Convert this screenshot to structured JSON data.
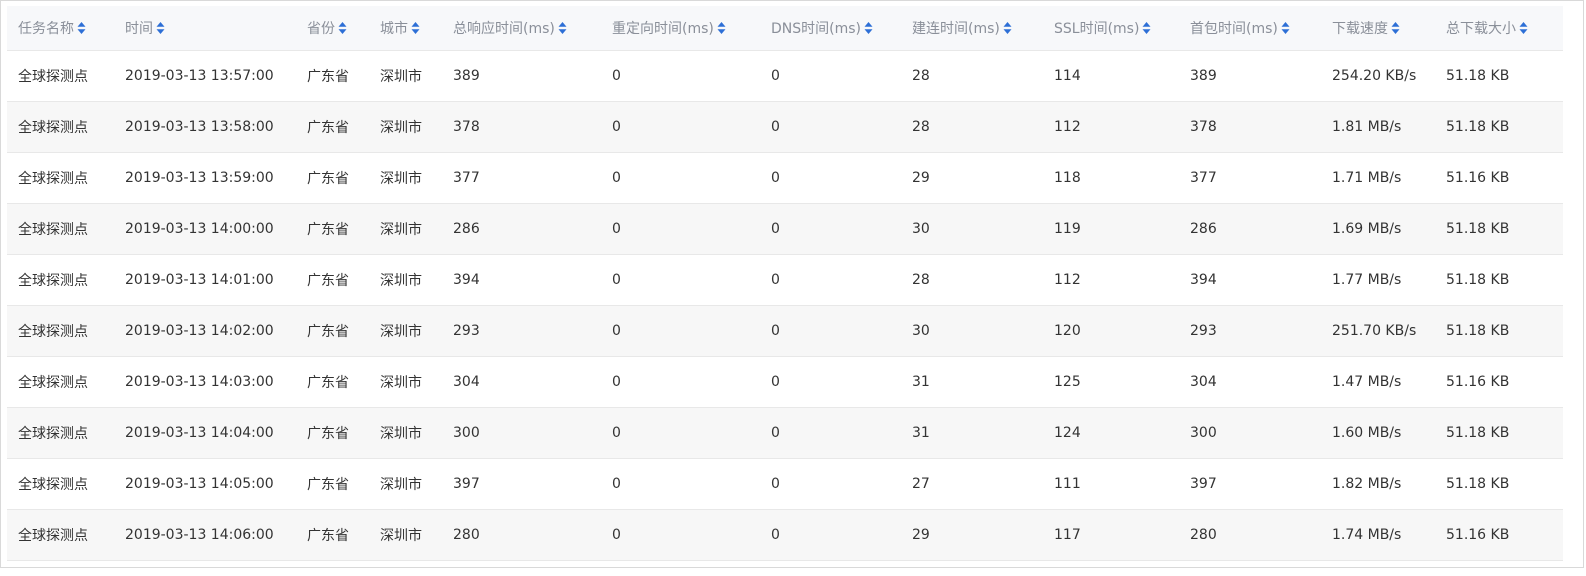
{
  "table": {
    "columns": [
      {
        "key": "task",
        "label": "任务名称"
      },
      {
        "key": "time",
        "label": "时间"
      },
      {
        "key": "province",
        "label": "省份"
      },
      {
        "key": "city",
        "label": "城市"
      },
      {
        "key": "total",
        "label": "总响应时间(ms)"
      },
      {
        "key": "redirect",
        "label": "重定向时间(ms)"
      },
      {
        "key": "dns",
        "label": "DNS时间(ms)"
      },
      {
        "key": "connect",
        "label": "建连时间(ms)"
      },
      {
        "key": "ssl",
        "label": "SSL时间(ms)"
      },
      {
        "key": "firstbyte",
        "label": "首包时间(ms)"
      },
      {
        "key": "speed",
        "label": "下载速度"
      },
      {
        "key": "size",
        "label": "总下载大小"
      }
    ],
    "rows": [
      [
        "全球探测点",
        "2019-03-13 13:57:00",
        "广东省",
        "深圳市",
        "389",
        "0",
        "0",
        "28",
        "114",
        "389",
        "254.20 KB/s",
        "51.18 KB"
      ],
      [
        "全球探测点",
        "2019-03-13 13:58:00",
        "广东省",
        "深圳市",
        "378",
        "0",
        "0",
        "28",
        "112",
        "378",
        "1.81 MB/s",
        "51.18 KB"
      ],
      [
        "全球探测点",
        "2019-03-13 13:59:00",
        "广东省",
        "深圳市",
        "377",
        "0",
        "0",
        "29",
        "118",
        "377",
        "1.71 MB/s",
        "51.16 KB"
      ],
      [
        "全球探测点",
        "2019-03-13 14:00:00",
        "广东省",
        "深圳市",
        "286",
        "0",
        "0",
        "30",
        "119",
        "286",
        "1.69 MB/s",
        "51.18 KB"
      ],
      [
        "全球探测点",
        "2019-03-13 14:01:00",
        "广东省",
        "深圳市",
        "394",
        "0",
        "0",
        "28",
        "112",
        "394",
        "1.77 MB/s",
        "51.18 KB"
      ],
      [
        "全球探测点",
        "2019-03-13 14:02:00",
        "广东省",
        "深圳市",
        "293",
        "0",
        "0",
        "30",
        "120",
        "293",
        "251.70 KB/s",
        "51.18 KB"
      ],
      [
        "全球探测点",
        "2019-03-13 14:03:00",
        "广东省",
        "深圳市",
        "304",
        "0",
        "0",
        "31",
        "125",
        "304",
        "1.47 MB/s",
        "51.16 KB"
      ],
      [
        "全球探测点",
        "2019-03-13 14:04:00",
        "广东省",
        "深圳市",
        "300",
        "0",
        "0",
        "31",
        "124",
        "300",
        "1.60 MB/s",
        "51.18 KB"
      ],
      [
        "全球探测点",
        "2019-03-13 14:05:00",
        "广东省",
        "深圳市",
        "397",
        "0",
        "0",
        "27",
        "111",
        "397",
        "1.82 MB/s",
        "51.18 KB"
      ],
      [
        "全球探测点",
        "2019-03-13 14:06:00",
        "广东省",
        "深圳市",
        "280",
        "0",
        "0",
        "29",
        "117",
        "280",
        "1.74 MB/s",
        "51.16 KB"
      ]
    ]
  },
  "icons": {
    "sort": "sort-icon"
  },
  "colors": {
    "sort_up": "#2d6fd6",
    "sort_down": "#2d6fd6",
    "header_text": "#8a8f99",
    "header_bg": "#f7f8fa",
    "row_alt_bg": "#f7f7f7"
  }
}
